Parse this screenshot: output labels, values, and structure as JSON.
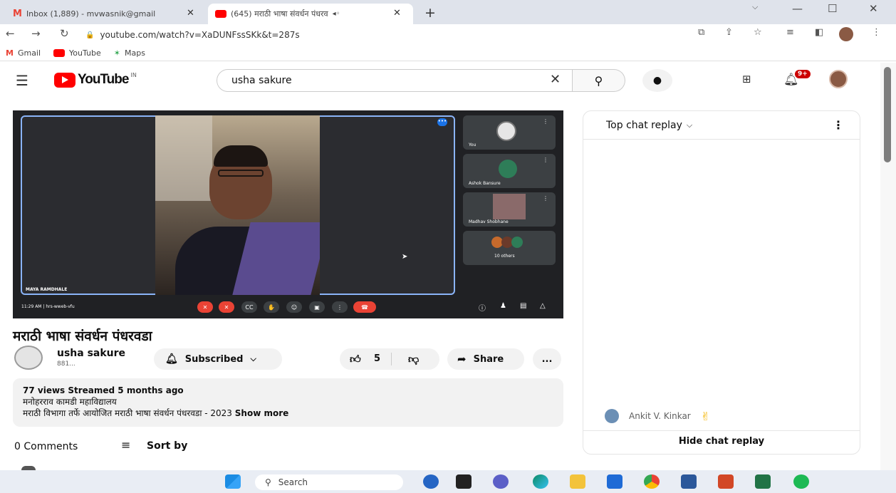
{
  "browser": {
    "tabs": [
      {
        "title": "Inbox (1,889) - mvwasnik@gmail",
        "close": "✕"
      },
      {
        "title": "(645) मराठी भाषा संवर्धन पंधरव",
        "close": "✕"
      }
    ],
    "new_tab": "+",
    "url": "youtube.com/watch?v=XaDUNFssSKk&t=287s",
    "bookmarks": [
      "Gmail",
      "YouTube",
      "Maps"
    ]
  },
  "youtube": {
    "logo": "YouTube",
    "logo_region": "IN",
    "search_value": "usha sakure",
    "notif_badge": "9+"
  },
  "video": {
    "speaker_name": "MAYA RAMDHALE",
    "meeting_time": "11:29 AM | hrs-wweb-vfu",
    "participants": [
      "You",
      "Ashok Bansure",
      "Madhav Shobhane",
      "10 others"
    ],
    "title": "मराठी भाषा संवर्धन पंधरवडा"
  },
  "channel": {
    "name": "usha sakure",
    "subs": "881...",
    "subscribe_label": "Subscribed",
    "likes": "5",
    "share_label": "Share",
    "more_label": "..."
  },
  "description": {
    "meta": "77 views  Streamed 5 months ago",
    "line1": "मनोहरराव कामडी महाविद्यालय",
    "line2": "मराठी विभागा   तर्फे आयोजित मराठी भाषा संवर्धन पंधरवडा  - 2023",
    "show_more": "Show more"
  },
  "comments": {
    "count_label": "0 Comments",
    "sort_label": "Sort by"
  },
  "chat": {
    "header": "Top chat replay",
    "messages": [
      {
        "author": "Ankit V. Kinkar",
        "emoji": "✌"
      }
    ],
    "hide_label": "Hide chat replay"
  },
  "taskbar": {
    "search_label": "Search"
  },
  "colors": {
    "yt_red": "#ff0000",
    "meet_red": "#ea4335",
    "meet_blue": "#8ab4f8"
  }
}
